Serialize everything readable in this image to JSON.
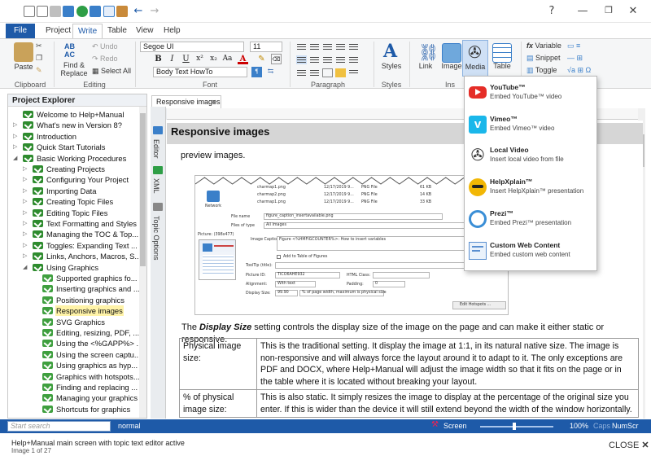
{
  "quick_access": {
    "icons": [
      "new-file-icon",
      "new-doc-icon",
      "save-icon",
      "save-all-icon",
      "refresh-icon",
      "dropdown-icon",
      "table-icon",
      "clipboard-icon",
      "back-arrow-icon",
      "forward-arrow-icon"
    ],
    "help": "?",
    "minimize": "—",
    "restore": "❐",
    "close": "✕"
  },
  "ribbon_tabs": [
    "File",
    "Project",
    "Write",
    "Table",
    "View",
    "Help"
  ],
  "ribbon_active_tab": "Write",
  "clipboard": {
    "paste": "Paste",
    "group": "Clipboard"
  },
  "editing": {
    "find_replace": "Find & Replace",
    "undo": "Undo",
    "redo": "Redo",
    "select_all": "Select All",
    "group": "Editing"
  },
  "font": {
    "family": "Segoe UI",
    "size": "11",
    "style": "Body Text HowTo",
    "buttons": [
      "B",
      "I",
      "U",
      "x²",
      "x₂",
      "Aa",
      "A"
    ],
    "group": "Font"
  },
  "paragraph": {
    "group": "Paragraph"
  },
  "styles": {
    "label": "Styles",
    "group": "Styles"
  },
  "insert": {
    "link": "Link",
    "image": "Image",
    "media": "Media",
    "table": "Table",
    "group": "Ins"
  },
  "variables": {
    "variable": "Variable",
    "snippet": "Snippet",
    "toggle": "Toggle"
  },
  "explorer": {
    "title": "Project Explorer",
    "items": [
      {
        "label": "Welcome to Help+Manual",
        "level": 1,
        "expand": ""
      },
      {
        "label": "What's new in Version 8?",
        "level": 1,
        "expand": "▷"
      },
      {
        "label": "Introduction",
        "level": 1,
        "expand": "▷"
      },
      {
        "label": "Quick Start Tutorials",
        "level": 1,
        "expand": "▷"
      },
      {
        "label": "Basic Working Procedures",
        "level": 1,
        "expand": "◢"
      },
      {
        "label": "Creating Projects",
        "level": 2,
        "expand": "▷"
      },
      {
        "label": "Configuring Your Project",
        "level": 2,
        "expand": "▷"
      },
      {
        "label": "Importing Data",
        "level": 2,
        "expand": "▷"
      },
      {
        "label": "Creating Topic Files",
        "level": 2,
        "expand": "▷"
      },
      {
        "label": "Editing Topic Files",
        "level": 2,
        "expand": "▷"
      },
      {
        "label": "Text Formatting and Styles",
        "level": 2,
        "expand": "▷"
      },
      {
        "label": "Managing the TOC & Top...",
        "level": 2,
        "expand": "▷"
      },
      {
        "label": "Toggles: Expanding Text ...",
        "level": 2,
        "expand": "▷"
      },
      {
        "label": "Links, Anchors, Macros, S...",
        "level": 2,
        "expand": "▷"
      },
      {
        "label": "Using Graphics",
        "level": 2,
        "expand": "◢"
      },
      {
        "label": "Supported graphics fo...",
        "level": 3,
        "expand": ""
      },
      {
        "label": "Inserting graphics and ...",
        "level": 3,
        "expand": ""
      },
      {
        "label": "Positioning graphics",
        "level": 3,
        "expand": ""
      },
      {
        "label": "Responsive images",
        "level": 3,
        "expand": "",
        "selected": true
      },
      {
        "label": "SVG Graphics",
        "level": 3,
        "expand": ""
      },
      {
        "label": "Editing, resizing, PDF, ...",
        "level": 3,
        "expand": ""
      },
      {
        "label": "Using the <%GAPP%> ...",
        "level": 3,
        "expand": ""
      },
      {
        "label": "Using the screen captu...",
        "level": 3,
        "expand": ""
      },
      {
        "label": "Using graphics as hyp...",
        "level": 3,
        "expand": ""
      },
      {
        "label": "Graphics with hotspots...",
        "level": 3,
        "expand": ""
      },
      {
        "label": "Finding and replacing ...",
        "level": 3,
        "expand": ""
      },
      {
        "label": "Managing your graphics",
        "level": 3,
        "expand": ""
      },
      {
        "label": "Shortcuts for graphics",
        "level": 3,
        "expand": ""
      }
    ]
  },
  "editor": {
    "tab": "Responsive images",
    "side_tabs": [
      "Editor",
      "XML",
      "Topic Options"
    ],
    "heading": "Responsive images",
    "intro_fragment": "preview images.",
    "para_prefix": "The ",
    "para_term": "Display Size",
    "para_suffix": " setting controls the display size of the image on the page and can make it either static or responsive.",
    "table": [
      {
        "term": "Physical image size:",
        "desc": "This is the traditional setting. It display the image at 1:1, in its natural native size. The image is non-responsive and will always force the layout around it to adapt to it. The only exceptions are PDF and DOCX, where Help+Manual will adjust the image width so that it fits on the page or in the table where it is located without breaking your layout."
      },
      {
        "term": "% of physical image size:",
        "desc": "This is also static. It simply resizes the image to display at the percentage of the original size you enter. If this is wider than the device it will still extend beyond the width of the window horizontally."
      }
    ]
  },
  "screenshot": {
    "files": [
      {
        "name": "charmap1.png",
        "date": "12/17/2019 9...",
        "type": "PNG File",
        "size": "61 KB"
      },
      {
        "name": "charmap2.png",
        "date": "12/17/2019 9...",
        "type": "PNG File",
        "size": "14 KB"
      },
      {
        "name": "charmap1.png",
        "date": "12/17/2019 9...",
        "type": "PNG File",
        "size": "33 KB"
      }
    ],
    "network": "Network",
    "file_name_label": "File name",
    "file_name": "figure_caption_insertavailable.png",
    "files_type_label": "Files of type",
    "files_type": "All Images",
    "picture_label": "Picture: (398x477)",
    "caption_label": "Image Caption:",
    "caption": "Figure <%HMFIGCOUNTER%>: How to insert variables",
    "add_toc": "Add to Table of Figures",
    "tooltip_label": "ToolTip (title):",
    "picture_id_label": "Picture ID:",
    "picture_id": "TICO6AHE932",
    "html_class_label": "HTML Class:",
    "alignment_label": "Alignment:",
    "alignment": "With text",
    "padding_label": "Padding:",
    "padding": "0",
    "display_size_label": "Display Size:",
    "display_size_value": "99.90",
    "display_size_mode": "% of page width, maximum is physical size",
    "edit_hotspots": "Edit Hotspots ..."
  },
  "media_menu": [
    {
      "title": "YouTube™",
      "desc": "Embed YouTube™ video",
      "icon": "youtube-icon",
      "color": "#e52d27"
    },
    {
      "title": "Vimeo™",
      "desc": "Embed Vimeo™ video",
      "icon": "vimeo-icon",
      "color": "#1ab7ea"
    },
    {
      "title": "Local Video",
      "desc": "Insert local video from file",
      "icon": "film-reel-icon",
      "color": "#444444"
    },
    {
      "title": "HelpXplain™",
      "desc": "Insert HelpXplain™ presentation",
      "icon": "helpxplain-icon",
      "color": "#f2b705"
    },
    {
      "title": "Prezi™",
      "desc": "Embed Prezi™ presentation",
      "icon": "prezi-icon",
      "color": "#3a8ed6"
    },
    {
      "title": "Custom Web Content",
      "desc": "Embed custom web content",
      "icon": "web-content-icon",
      "color": "#5a8fd0"
    }
  ],
  "status": {
    "search_placeholder": "Start search",
    "style": "normal",
    "screen": "Screen",
    "zoom": "100%",
    "caps": "Caps",
    "num": "Num",
    "scr": "Scr"
  },
  "caption": {
    "line1": "Help+Manual main screen with topic text editor active",
    "line2": "Image 1 of 27",
    "close": "CLOSE"
  },
  "colors": {
    "accent": "#1e5aa8",
    "selection": "#fff3a8",
    "heading_band": "#d6d6d6"
  }
}
